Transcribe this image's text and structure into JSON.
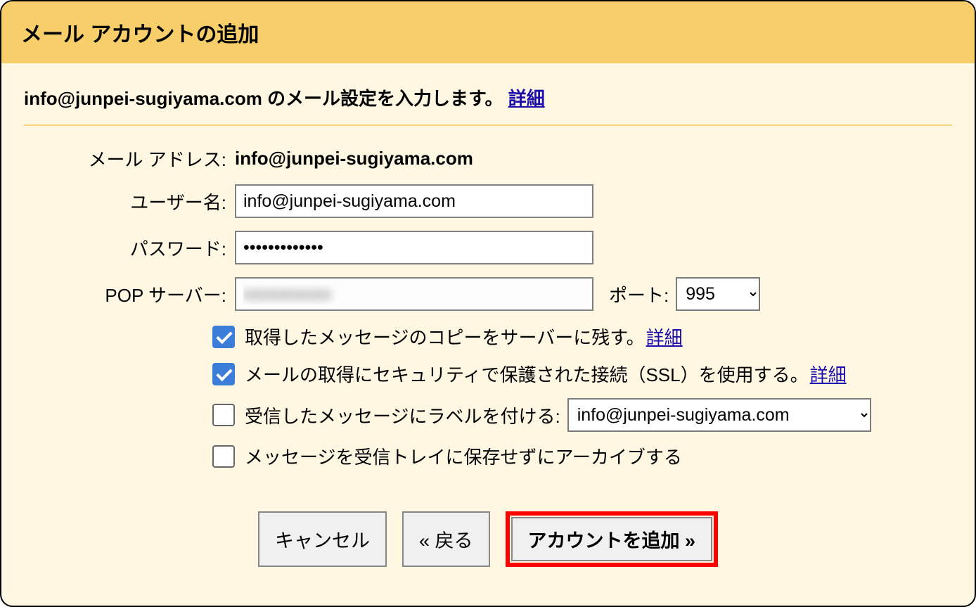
{
  "header": {
    "title": "メール アカウントの追加"
  },
  "instruction": {
    "text_prefix": "info@junpei-sugiyama.com のメール設定を入力します。",
    "detail_link": "詳細"
  },
  "form": {
    "email_label": "メール アドレス:",
    "email_value": "info@junpei-sugiyama.com",
    "username_label": "ユーザー名:",
    "username_value": "info@junpei-sugiyama.com",
    "password_label": "パスワード:",
    "password_value": "•••••••••••••",
    "pop_server_label": "POP サーバー:",
    "pop_server_value": "",
    "port_label": "ポート:",
    "port_value": "995"
  },
  "checkboxes": {
    "leave_copy": {
      "checked": true,
      "label": "取得したメッセージのコピーをサーバーに残す。",
      "link": "詳細"
    },
    "use_ssl": {
      "checked": true,
      "label": "メールの取得にセキュリティで保護された接続（SSL）を使用する。",
      "link": "詳細"
    },
    "apply_label": {
      "checked": false,
      "label": "受信したメッセージにラベルを付ける:",
      "select_value": "info@junpei-sugiyama.com"
    },
    "archive": {
      "checked": false,
      "label": "メッセージを受信トレイに保存せずにアーカイブする"
    }
  },
  "buttons": {
    "cancel": "キャンセル",
    "back": "« 戻る",
    "add_account": "アカウントを追加 »"
  }
}
